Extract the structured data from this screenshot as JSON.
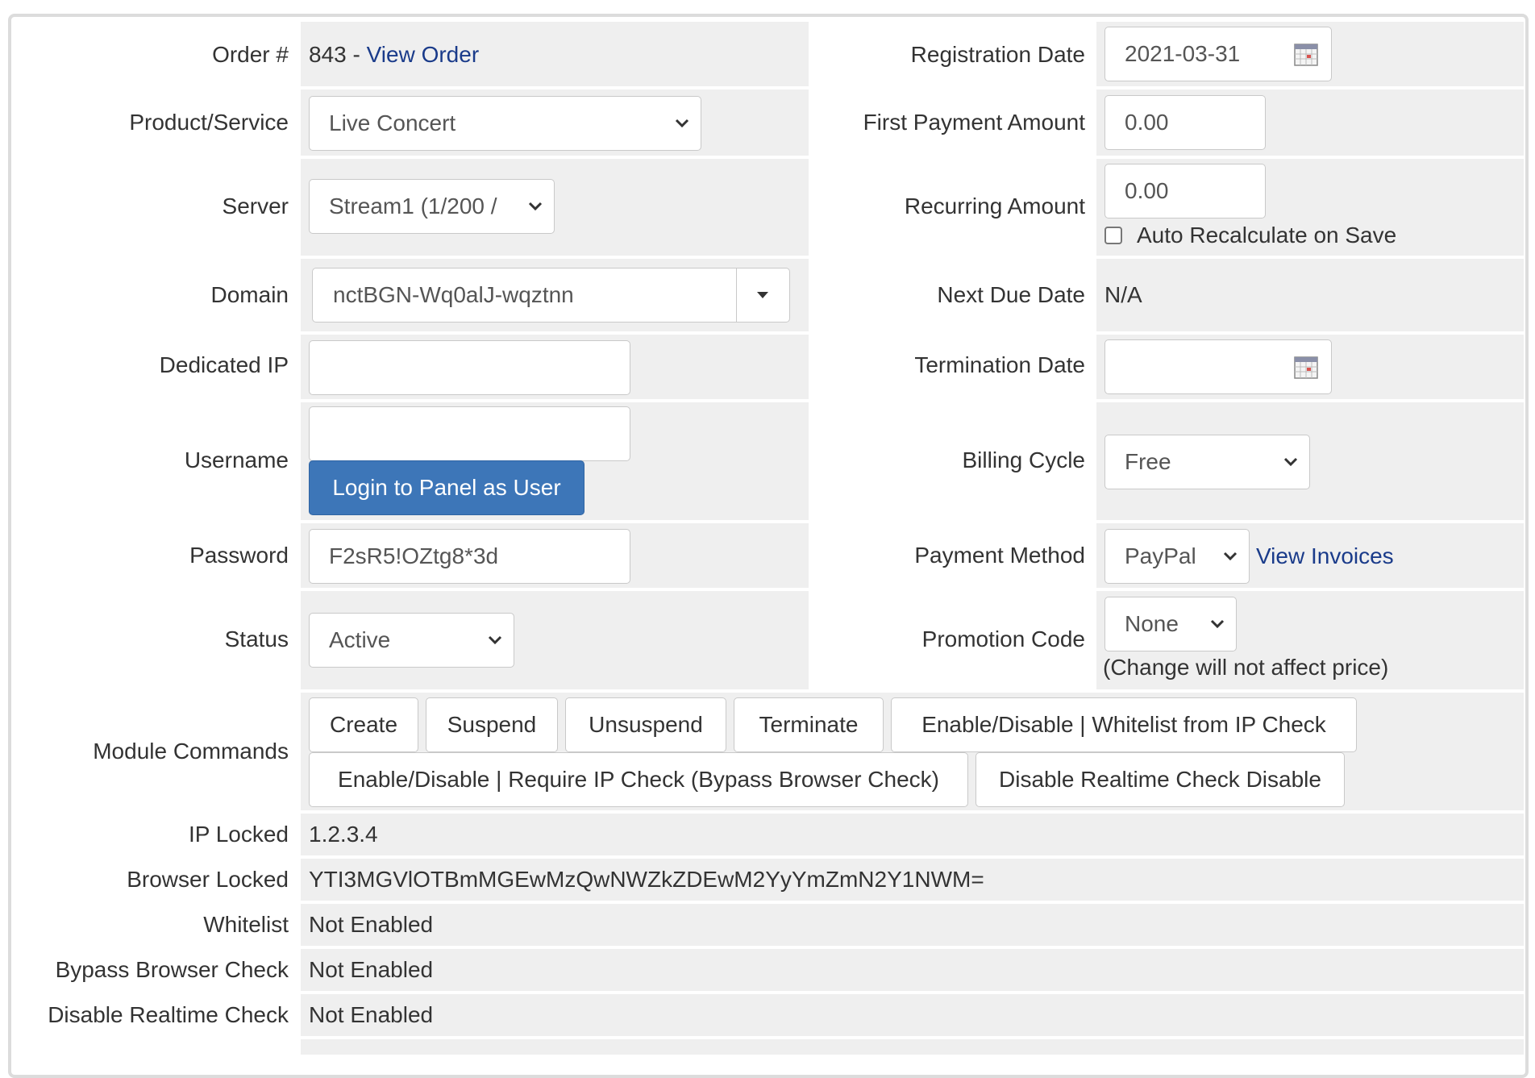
{
  "left": {
    "order": {
      "label": "Order #",
      "number": "843 - ",
      "view_link": "View Order"
    },
    "product": {
      "label": "Product/Service",
      "value": "Live Concert"
    },
    "server": {
      "label": "Server",
      "value": "Stream1 (1/200 /"
    },
    "domain": {
      "label": "Domain",
      "value": "nctBGN-Wq0alJ-wqztnn"
    },
    "dedicated_ip": {
      "label": "Dedicated IP",
      "value": ""
    },
    "username": {
      "label": "Username",
      "value": "",
      "login_button": "Login to Panel as User"
    },
    "password": {
      "label": "Password",
      "value": "F2sR5!OZtg8*3d"
    },
    "status": {
      "label": "Status",
      "value": "Active"
    }
  },
  "right": {
    "registration_date": {
      "label": "Registration Date",
      "value": "2021-03-31"
    },
    "first_payment": {
      "label": "First Payment Amount",
      "value": "0.00"
    },
    "recurring": {
      "label": "Recurring Amount",
      "value": "0.00",
      "auto_recalc": "Auto Recalculate on Save"
    },
    "next_due": {
      "label": "Next Due Date",
      "value": "N/A"
    },
    "termination": {
      "label": "Termination Date",
      "value": ""
    },
    "billing_cycle": {
      "label": "Billing Cycle",
      "value": "Free"
    },
    "payment_method": {
      "label": "Payment Method",
      "value": "PayPal",
      "view_invoices": "View Invoices"
    },
    "promotion": {
      "label": "Promotion Code",
      "value": "None",
      "note": "(Change will not affect price)"
    }
  },
  "module_commands": {
    "label": "Module Commands",
    "buttons": [
      "Create",
      "Suspend",
      "Unsuspend",
      "Terminate",
      "Enable/Disable | Whitelist from IP Check",
      "Enable/Disable | Require IP Check (Bypass Browser Check)",
      "Disable Realtime Check Disable"
    ]
  },
  "info": {
    "ip_locked": {
      "label": "IP Locked",
      "value": "1.2.3.4"
    },
    "browser_locked": {
      "label": "Browser Locked",
      "value": "YTI3MGVlOTBmMGEwMzQwNWZkZDEwM2YyYmZmN2Y1NWM="
    },
    "whitelist": {
      "label": "Whitelist",
      "value": "Not Enabled"
    },
    "bypass": {
      "label": "Bypass Browser Check",
      "value": "Not Enabled"
    },
    "realtime": {
      "label": "Disable Realtime Check",
      "value": "Not Enabled"
    }
  },
  "icons": {
    "calendar": "calendar-icon",
    "caret": "chevron-down-icon"
  },
  "colors": {
    "link": "#1a3b8a",
    "primary_button": "#3d76b8",
    "cell_background": "#efefef"
  }
}
